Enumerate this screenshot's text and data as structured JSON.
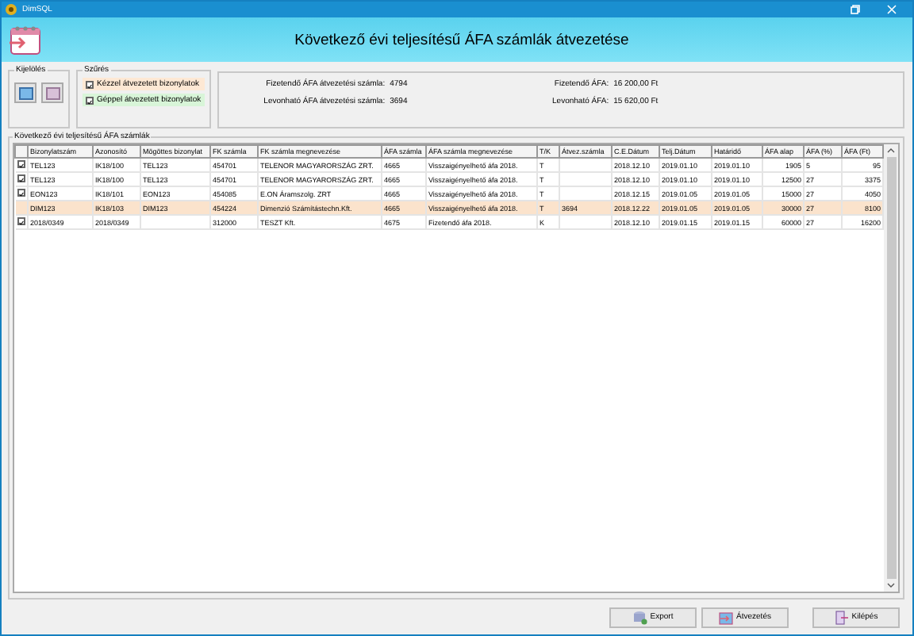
{
  "window": {
    "title": "DimSQL"
  },
  "header": {
    "title": "Következő évi teljesítésű ÁFA számlák átvezetése"
  },
  "selection_group": {
    "label": "Kijelölés"
  },
  "filter_group": {
    "label": "Szűrés",
    "options": [
      {
        "label": "Kézzel átvezetett bizonylatok",
        "checked": true,
        "color": "#fde8d4"
      },
      {
        "label": "Géppel átvezetett bizonylatok",
        "checked": true,
        "color": "#d8f5d8"
      }
    ]
  },
  "summary": [
    {
      "label": "Fizetendő ÁFA átvezetési számla:",
      "value": "4794",
      "label2": "Fizetendő ÁFA:",
      "value2": "16 200,00  Ft"
    },
    {
      "label": "Levonható ÁFA átvezetési számla:",
      "value": "3694",
      "label2": "Levonható ÁFA:",
      "value2": "15 620,00  Ft"
    }
  ],
  "table": {
    "label": "Következő évi teljesítésű ÁFA számlák",
    "columns": [
      "Bizonylatszám",
      "Azonosító",
      "Mögöttes bizonylat",
      "FK számla",
      "FK számla megnevezése",
      "ÁFA számla",
      "ÁFA számla megnevezése",
      "T/K",
      "Átvez.számla",
      "C.E.Dátum",
      "Telj.Dátum",
      "Határidő",
      "ÁFA alap",
      "ÁFA (%)",
      "ÁFA (Ft)"
    ],
    "rows": [
      {
        "checked": true,
        "selected": false,
        "cells": [
          "TEL123",
          "IK18/100",
          "TEL123",
          "454701",
          "TELENOR MAGYARORSZÁG ZRT.",
          "4665",
          "Visszaigényelhető áfa 2018.",
          "T",
          "",
          "2018.12.10",
          "2019.01.10",
          "2019.01.10",
          "1905",
          "5",
          "95"
        ]
      },
      {
        "checked": true,
        "selected": false,
        "cells": [
          "TEL123",
          "IK18/100",
          "TEL123",
          "454701",
          "TELENOR MAGYARORSZÁG ZRT.",
          "4665",
          "Visszaigényelhető áfa 2018.",
          "T",
          "",
          "2018.12.10",
          "2019.01.10",
          "2019.01.10",
          "12500",
          "27",
          "3375"
        ]
      },
      {
        "checked": true,
        "selected": false,
        "cells": [
          "EON123",
          "IK18/101",
          "EON123",
          "454085",
          "E.ON Áramszolg. ZRT",
          "4665",
          "Visszaigényelhető áfa 2018.",
          "T",
          "",
          "2018.12.15",
          "2019.01.05",
          "2019.01.05",
          "15000",
          "27",
          "4050"
        ]
      },
      {
        "checked": false,
        "selected": true,
        "cells": [
          "DIM123",
          "IK18/103",
          "DIM123",
          "454224",
          "Dimenzió Számítástechn.Kft.",
          "4665",
          "Visszaigényelhető áfa 2018.",
          "T",
          "3694",
          "2018.12.22",
          "2019.01.05",
          "2019.01.05",
          "30000",
          "27",
          "8100"
        ]
      },
      {
        "checked": true,
        "selected": false,
        "cells": [
          "2018/0349",
          "2018/0349",
          "",
          "312000",
          "TESZT Kft.",
          "4675",
          "Fizetendő áfa 2018.",
          "K",
          "",
          "2018.12.10",
          "2019.01.15",
          "2019.01.15",
          "60000",
          "27",
          "16200"
        ]
      }
    ]
  },
  "buttons": [
    {
      "label": "Export",
      "kind": "export"
    },
    {
      "label": "Átvezetés",
      "kind": "transfer"
    },
    {
      "label": "Kilépés",
      "kind": "exit"
    }
  ]
}
